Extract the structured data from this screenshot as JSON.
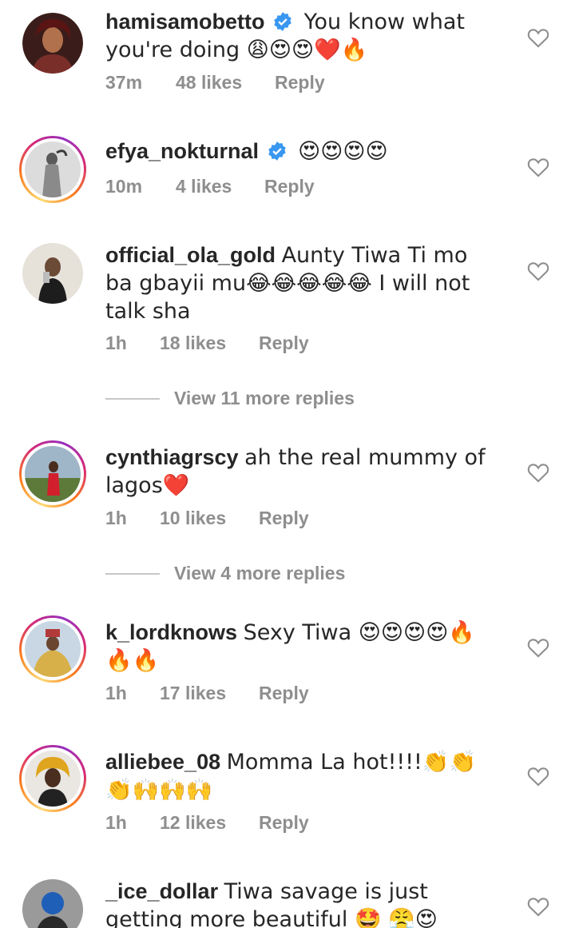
{
  "comments": [
    {
      "username": "hamisamobetto",
      "verified": true,
      "text": "You know what you're doing 😩😍😍❤️🔥",
      "time": "37m",
      "likes": "48 likes",
      "reply": "Reply"
    },
    {
      "username": "efya_nokturnal",
      "verified": true,
      "text": "😍😍😍😍",
      "time": "10m",
      "likes": "4 likes",
      "reply": "Reply"
    },
    {
      "username": "official_ola_gold",
      "verified": false,
      "text": "Aunty Tiwa Ti mo ba gbayii mu😂😂😂😂😂 I will not talk sha",
      "time": "1h",
      "likes": "18 likes",
      "reply": "Reply",
      "view_more": "View 11 more replies"
    },
    {
      "username": "cynthiagrscy",
      "verified": false,
      "text": "ah the real mummy of lagos❤️",
      "time": "1h",
      "likes": "10 likes",
      "reply": "Reply",
      "view_more": "View 4 more replies"
    },
    {
      "username": "k_lordknows",
      "verified": false,
      "text": "Sexy Tiwa 😍😍😍😍🔥🔥🔥",
      "time": "1h",
      "likes": "17 likes",
      "reply": "Reply"
    },
    {
      "username": "alliebee_08",
      "verified": false,
      "text": "Momma La hot!!!!👏👏👏🙌🙌🙌",
      "time": "1h",
      "likes": "12 likes",
      "reply": "Reply"
    },
    {
      "username": "_ice_dollar",
      "verified": false,
      "text": "Tiwa savage is just getting more beautiful 🤩 😤😍everyday"
    }
  ],
  "colors": {
    "text": "#262626",
    "muted": "#8e8e8e",
    "verified": "#3897f0",
    "divider": "#c7c7c7"
  }
}
